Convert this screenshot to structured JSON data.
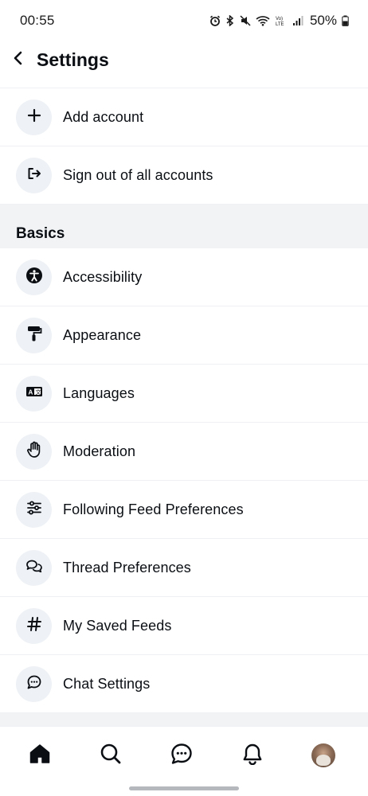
{
  "status_bar": {
    "time": "00:55",
    "battery": "50%",
    "icons": [
      "alarm-icon",
      "bluetooth-icon",
      "mute-icon",
      "wifi-icon",
      "volte-icon",
      "signal-icon",
      "battery-icon"
    ]
  },
  "header": {
    "title": "Settings",
    "back_icon": "chevron-left-icon"
  },
  "accounts": [
    {
      "label": "Add account",
      "icon": "plus-icon"
    },
    {
      "label": "Sign out of all accounts",
      "icon": "sign-out-icon"
    }
  ],
  "basics": {
    "title": "Basics",
    "items": [
      {
        "label": "Accessibility",
        "icon": "accessibility-icon"
      },
      {
        "label": "Appearance",
        "icon": "paint-roller-icon"
      },
      {
        "label": "Languages",
        "icon": "language-icon"
      },
      {
        "label": "Moderation",
        "icon": "hand-icon"
      },
      {
        "label": "Following Feed Preferences",
        "icon": "sliders-icon"
      },
      {
        "label": "Thread Preferences",
        "icon": "chat-bubbles-icon"
      },
      {
        "label": "My Saved Feeds",
        "icon": "hashtag-icon"
      },
      {
        "label": "Chat Settings",
        "icon": "chat-bubble-icon"
      }
    ]
  },
  "bottom_nav": {
    "items": [
      "home-icon",
      "search-icon",
      "messages-icon",
      "notifications-icon",
      "profile-avatar"
    ],
    "active": "home-icon"
  },
  "colors": {
    "text": "#0b0f14",
    "icon_bg": "#eef1f5",
    "section_bg": "#f1f3f5",
    "divider": "#eef0f3"
  }
}
